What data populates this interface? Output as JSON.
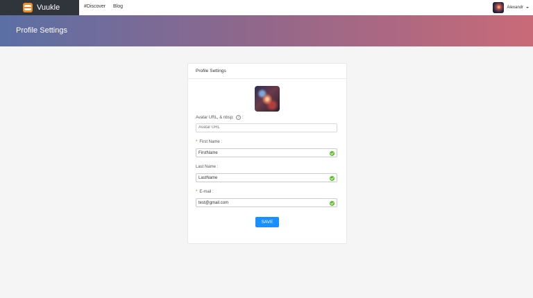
{
  "nav": {
    "brand": "Vuukle",
    "links": [
      "#Discover",
      "Blog"
    ],
    "user_name": "Alexandr"
  },
  "banner": {
    "title": "Profile Settings"
  },
  "card": {
    "header": "Profile Settings",
    "fields": {
      "avatar": {
        "label": "Avatar URL, & nbsp;",
        "suffix": ":",
        "placeholder": "Avatar URL",
        "value": ""
      },
      "first_name": {
        "label": "First Name",
        "suffix": ":",
        "value": "FirstName"
      },
      "last_name": {
        "label": "Last Name",
        "suffix": ":",
        "value": "LastName"
      },
      "email": {
        "label": "E-mail",
        "suffix": ":",
        "value": "test@gmail.com"
      }
    },
    "save_label": "SAVE"
  },
  "icons": {
    "help": "?",
    "check": "check-circle-icon",
    "logo": "sandwich-logo-icon"
  },
  "colors": {
    "primary": "#1890ff",
    "success": "#52c41a",
    "required": "#e74c3c",
    "banner_start": "#5b6fa5",
    "banner_end": "#c96a78",
    "brand_bg": "#30343b"
  }
}
